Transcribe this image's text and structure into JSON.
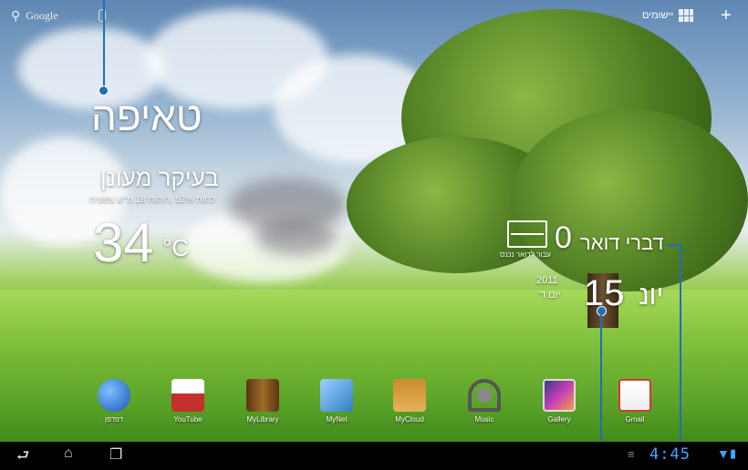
{
  "top_bar": {
    "search_label": "Google",
    "apps_label": "יישומים"
  },
  "weather": {
    "city": "טאיפה",
    "condition": "בעיקר מעונן",
    "details": "לחות 52% ,רוחות 18 מ\"ש צפונית",
    "temperature": "34",
    "unit": "°C"
  },
  "mail": {
    "title": "דברי דואר",
    "count": "0",
    "subtitle": "עבור לדואר נכנס"
  },
  "date": {
    "day_number": "15",
    "month": "יונ",
    "year": "2011",
    "weekday": "יום ד'"
  },
  "dock": {
    "apps": [
      {
        "label": "דפדפן",
        "color": "#2a6fd6",
        "icon": "globe-icon"
      },
      {
        "label": "YouTube",
        "color": "#c4302b",
        "icon": "youtube-icon"
      },
      {
        "label": "MyLibrary",
        "color": "#7a4a1f",
        "icon": "book-icon"
      },
      {
        "label": "MyNet",
        "color": "#2f7fc2",
        "icon": "network-icon"
      },
      {
        "label": "MyCloud",
        "color": "#c99a3a",
        "icon": "cloud-box-icon"
      },
      {
        "label": "Music",
        "color": "#5a5a5a",
        "icon": "headphones-icon"
      },
      {
        "label": "Gallery",
        "color": "#a23fb0",
        "icon": "gallery-icon"
      },
      {
        "label": "Gmail",
        "color": "#d23b2f",
        "icon": "gmail-icon"
      }
    ]
  },
  "status": {
    "time": "4:45"
  },
  "colors": {
    "callout": "#1e6fb8",
    "clock": "#3ea6ff"
  }
}
